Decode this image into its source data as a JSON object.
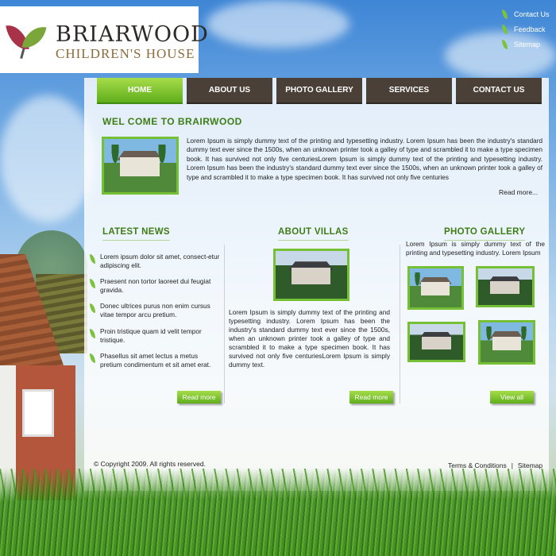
{
  "logo": {
    "title": "BRIARWOOD",
    "subtitle": "CHILDREN'S HOUSE"
  },
  "top_links": [
    "Contact Us",
    "Feedback",
    "Sitemap"
  ],
  "nav": [
    "HOME",
    "ABOUT US",
    "PHOTO GALLERY",
    "SERVICES",
    "CONTACT US"
  ],
  "welcome": {
    "title": "WEL COME TO BRAIRWOOD",
    "text": "Lorem Ipsum is simply dummy text of the printing and typesetting industry. Lorem Ipsum has been the industry's standard dummy text ever since the 1500s, when an unknown printer took a galley of type and scrambled it to make a type specimen book. It has survived not only five centuriesLorem Ipsum is simply dummy text of the printing and typesetting industry. Lorem Ipsum has been the industry's standard dummy text ever since the 1500s, when an unknown printer took a galley of type and scrambled it to make a type specimen book. It has survived not only five centuries",
    "read_more": "Read more..."
  },
  "latest_news": {
    "title": "LATEST NEWS",
    "items": [
      "Lorem ipsum dolor sit amet, consect-etur adipiscing elit.",
      "Praesent non tortor laoreet dui feugiat gravida.",
      "Donec ultrices purus non enim cursus vitae tempor arcu pretium.",
      "Proin tristique quam id velit tempor tristique.",
      "Phasellus sit amet lectus a metus pretium condimentum et sit amet erat."
    ],
    "button": "Read more"
  },
  "about_villas": {
    "title": "ABOUT VILLAS",
    "text": "Lorem Ipsum is simply dummy text of the printing and typesetting industry. Lorem Ipsum has been the industry's standard dummy text ever since the 1500s, when an unknown printer took a galley of type and scrambled it to make a type specimen book. It has survived not only five centuriesLorem Ipsum is simply dummy text.",
    "button": "Read more"
  },
  "photo_gallery": {
    "title": "PHOTO GALLERY",
    "text": "Lorem Ipsum is simply dummy text of the printing and typesetting industry. Lorem Ipsum",
    "button": "View all"
  },
  "footer": {
    "copyright": "© Copyright 2009. All rights reserved.",
    "links": [
      "Terms & Conditions",
      "|",
      "Sitemap"
    ]
  },
  "colors": {
    "accent_green": "#5fae1c",
    "nav_dark": "#4a4038",
    "title_green": "#3e7d16"
  }
}
